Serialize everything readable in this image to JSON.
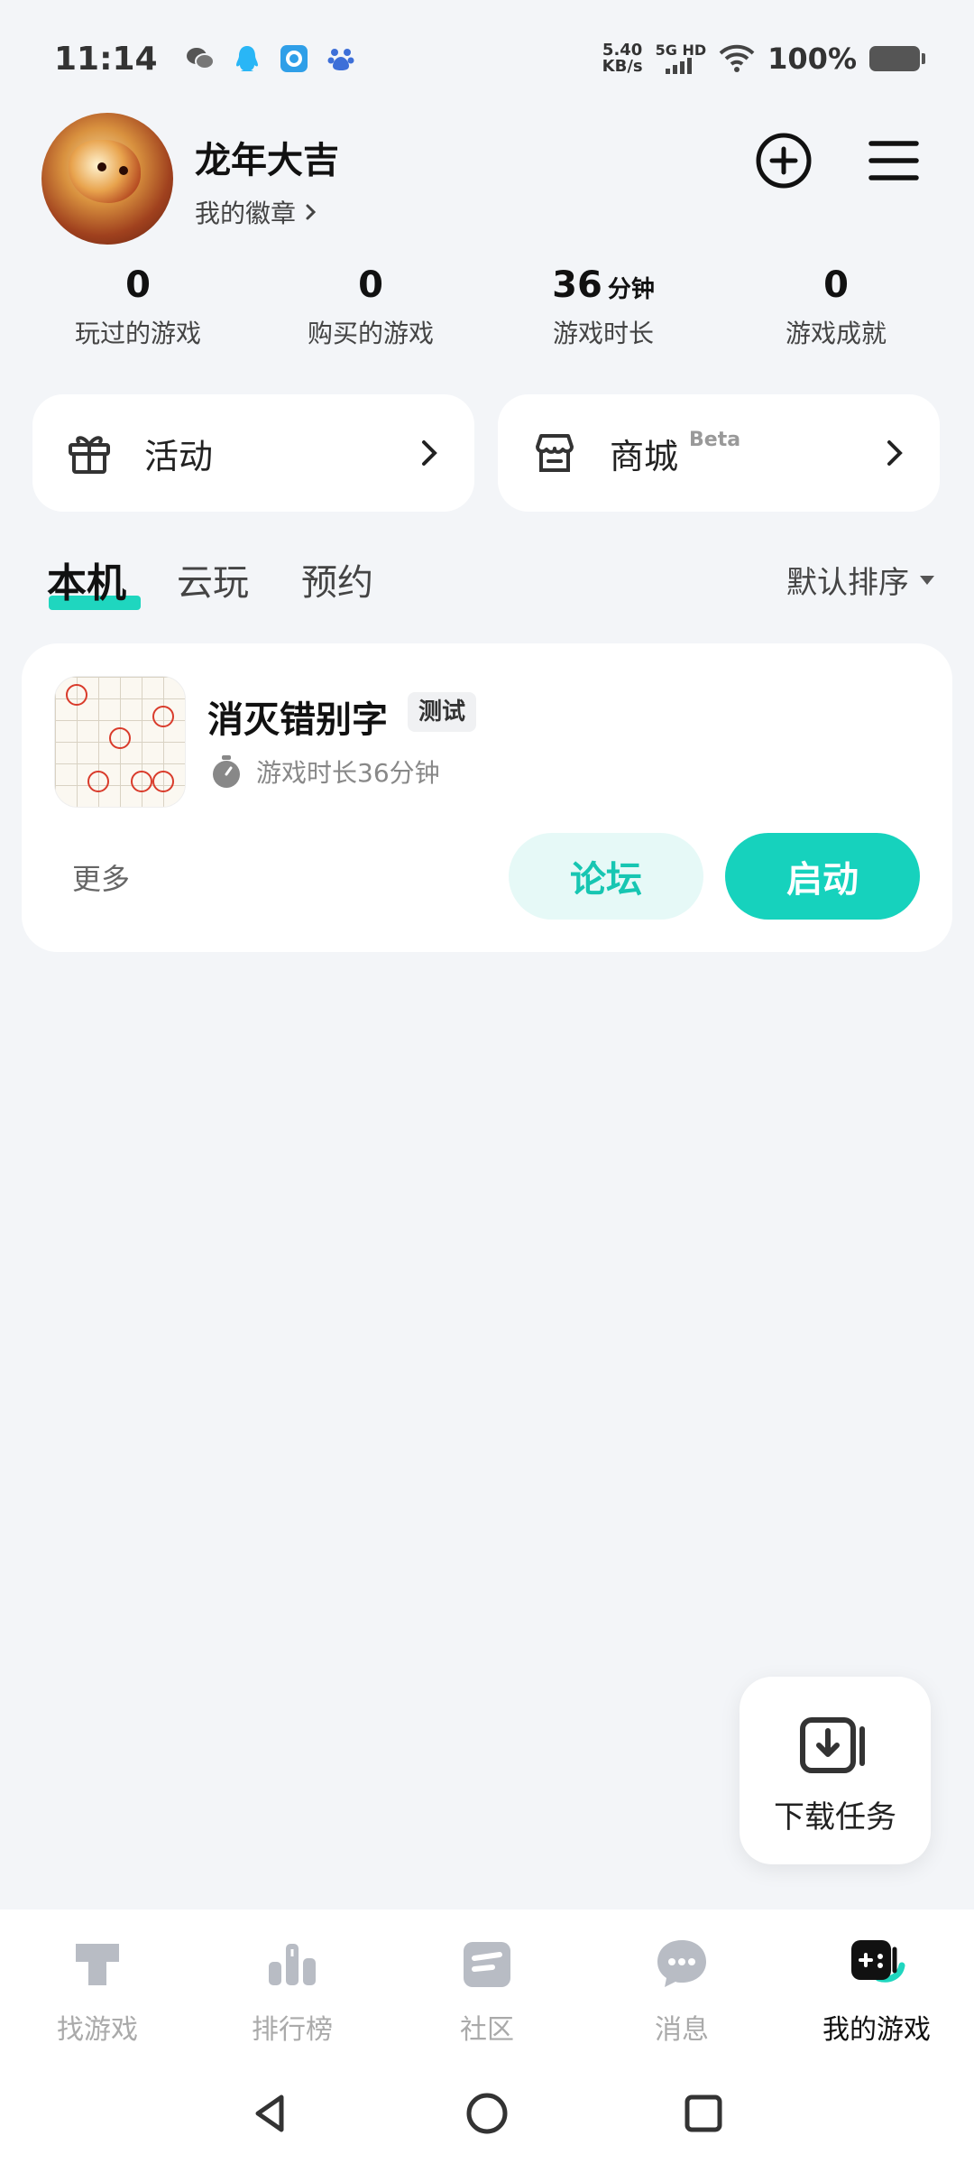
{
  "status_bar": {
    "time": "11:14",
    "net_speed": "5.40",
    "net_unit": "KB/s",
    "network": "5G HD",
    "battery": "100%"
  },
  "profile": {
    "username": "龙年大吉",
    "badge_link": "我的徽章"
  },
  "stats": [
    {
      "value": "0",
      "unit": "",
      "label": "玩过的游戏"
    },
    {
      "value": "0",
      "unit": "",
      "label": "购买的游戏"
    },
    {
      "value": "36",
      "unit": "分钟",
      "label": "游戏时长"
    },
    {
      "value": "0",
      "unit": "",
      "label": "游戏成就"
    }
  ],
  "quick_cards": {
    "activity": {
      "label": "活动"
    },
    "shop": {
      "label": "商城",
      "badge": "Beta"
    }
  },
  "tabs": [
    {
      "label": "本机",
      "active": true
    },
    {
      "label": "云玩",
      "active": false
    },
    {
      "label": "预约",
      "active": false
    }
  ],
  "sort": {
    "label": "默认排序"
  },
  "game": {
    "title": "消灭错别字",
    "tag": "测试",
    "playtime": "游戏时长36分钟",
    "more_label": "更多",
    "forum_label": "论坛",
    "launch_label": "启动"
  },
  "download_task": {
    "label": "下载任务"
  },
  "bottom_nav": [
    {
      "label": "找游戏",
      "icon": "find-games-icon"
    },
    {
      "label": "排行榜",
      "icon": "ranking-icon"
    },
    {
      "label": "社区",
      "icon": "community-icon"
    },
    {
      "label": "消息",
      "icon": "message-icon"
    },
    {
      "label": "我的游戏",
      "icon": "my-games-icon",
      "active": true
    }
  ],
  "colors": {
    "accent": "#16d2bd",
    "accent_light": "#e6f9f7",
    "background": "#f3f5f8"
  }
}
